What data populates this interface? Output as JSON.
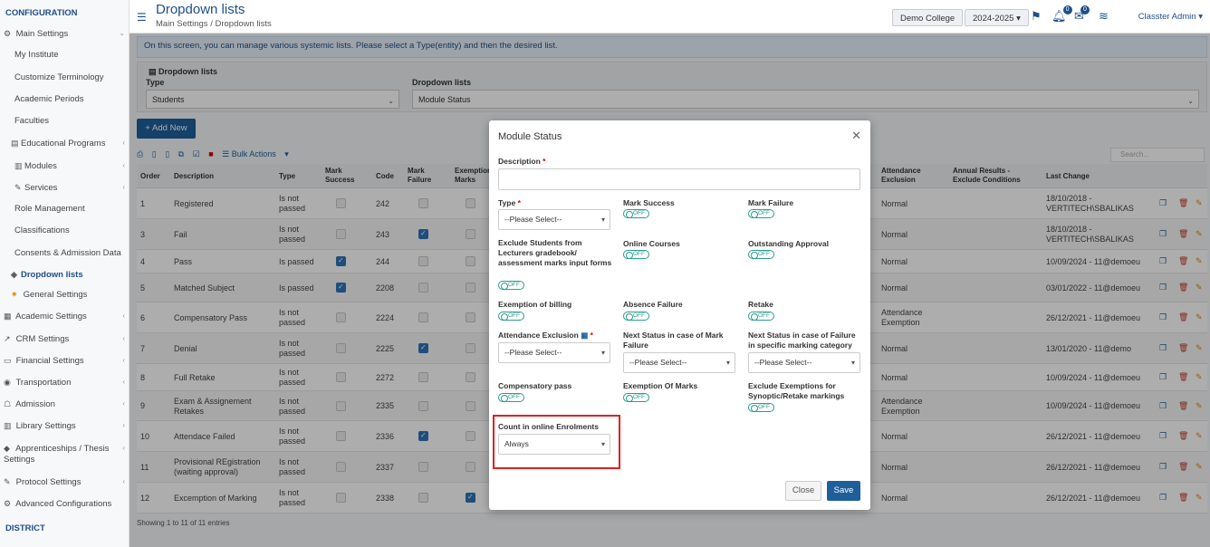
{
  "sidebar": {
    "header": "CONFIGURATION",
    "items": [
      {
        "label": "Main Settings"
      },
      {
        "label": "My Institute"
      },
      {
        "label": "Customize Terminology"
      },
      {
        "label": "Academic Periods"
      },
      {
        "label": "Faculties"
      },
      {
        "label": "Educational Programs"
      },
      {
        "label": "Modules"
      },
      {
        "label": "Services"
      },
      {
        "label": "Role Management"
      },
      {
        "label": "Classifications"
      },
      {
        "label": "Consents & Admission Data"
      },
      {
        "label": "Dropdown lists"
      },
      {
        "label": "General Settings"
      },
      {
        "label": "Academic Settings"
      },
      {
        "label": "CRM Settings"
      },
      {
        "label": "Financial Settings"
      },
      {
        "label": "Transportation"
      },
      {
        "label": "Admission"
      },
      {
        "label": "Library Settings"
      },
      {
        "label": "Apprenticeships / Thesis"
      },
      {
        "label": "Settings"
      },
      {
        "label": "Protocol Settings"
      },
      {
        "label": "Advanced Configurations"
      }
    ],
    "footer": "DISTRICT"
  },
  "header": {
    "title": "Dropdown lists",
    "breadcrumb_1": "Main Settings",
    "breadcrumb_sep": "/",
    "breadcrumb_2": "Dropdown lists",
    "college": "Demo College",
    "year": "2024-2025",
    "notif_count": "0",
    "msg_count": "0",
    "user": "Classter Admin"
  },
  "info_text": "On this screen, you can manage various systemic lists. Please select a Type(entity) and then the desired list.",
  "filter": {
    "title": "Dropdown lists",
    "type_label": "Type",
    "type_value": "Students",
    "list_label": "Dropdown lists",
    "list_value": "Module Status"
  },
  "add_new": "+ Add New",
  "bulk_actions": "Bulk Actions",
  "search_placeholder": "Search...",
  "table": {
    "headers": {
      "order": "Order",
      "description": "Description",
      "type": "Type",
      "mark_success_1": "Mark",
      "mark_success_2": "Success",
      "code": "Code",
      "mark_failure_1": "Mark",
      "mark_failure_2": "Failure",
      "exemption_1": "Exemption",
      "exemption_2": "Marks",
      "att_excl_1": "Attendance",
      "att_excl_2": "Exclusion",
      "annual_1": "Annual Results -",
      "annual_2": "Exclude Conditions",
      "last_change": "Last Change"
    },
    "rows": [
      {
        "order": "1",
        "desc": "Registered",
        "type": "Is not passed",
        "ms": false,
        "code": "242",
        "mf": false,
        "ex": false,
        "att": "Normal",
        "last": "18/10/2018 - VERTITECH\\SBALIKAS"
      },
      {
        "order": "3",
        "desc": "Fail",
        "type": "Is not passed",
        "ms": false,
        "code": "243",
        "mf": true,
        "ex": false,
        "att": "Normal",
        "last": "18/10/2018 - VERTITECH\\SBALIKAS"
      },
      {
        "order": "4",
        "desc": "Pass",
        "type": "Is passed",
        "ms": true,
        "code": "244",
        "mf": false,
        "ex": false,
        "att": "Normal",
        "last": "10/09/2024 - 11@demoeu"
      },
      {
        "order": "5",
        "desc": "Matched Subject",
        "type": "Is passed",
        "ms": true,
        "code": "2208",
        "mf": false,
        "ex": false,
        "att": "Normal",
        "last": "03/01/2022 - 11@demoeu"
      },
      {
        "order": "6",
        "desc": "Compensatory Pass",
        "type": "Is not passed",
        "ms": false,
        "code": "2224",
        "mf": false,
        "ex": false,
        "att": "Attendance Exemption",
        "last": "26/12/2021 - 11@demoeu"
      },
      {
        "order": "7",
        "desc": "Denial",
        "type": "Is not passed",
        "ms": false,
        "code": "2225",
        "mf": true,
        "ex": false,
        "att": "Normal",
        "last": "13/01/2020 - 11@demo"
      },
      {
        "order": "8",
        "desc": "Full Retake",
        "type": "Is not passed",
        "ms": false,
        "code": "2272",
        "mf": false,
        "ex": false,
        "att": "Normal",
        "last": "10/09/2024 - 11@demoeu"
      },
      {
        "order": "9",
        "desc": "Exam & Assignement Retakes",
        "type": "Is not passed",
        "ms": false,
        "code": "2335",
        "mf": false,
        "ex": false,
        "att": "Attendance Exemption",
        "last": "10/09/2024 - 11@demoeu"
      },
      {
        "order": "10",
        "desc": "Attendace Failed",
        "type": "Is not passed",
        "ms": false,
        "code": "2336",
        "mf": true,
        "ex": false,
        "att": "Normal",
        "last": "26/12/2021 - 11@demoeu"
      },
      {
        "order": "11",
        "desc": "Provisional REgistration (waiting approval)",
        "type": "Is not passed",
        "ms": false,
        "code": "2337",
        "mf": false,
        "ex": false,
        "att": "Normal",
        "last": "26/12/2021 - 11@demoeu"
      },
      {
        "order": "12",
        "desc": "Excemption of Marking",
        "type": "Is not passed",
        "ms": false,
        "code": "2338",
        "mf": false,
        "ex": true,
        "att": "Normal",
        "last": "26/12/2021 - 11@demoeu"
      }
    ]
  },
  "showing": "Showing 1 to 11 of 11 entries",
  "modal": {
    "title": "Module Status",
    "description_label": "Description",
    "type_label": "Type",
    "type_value": "--Please Select--",
    "mark_success": "Mark Success",
    "mark_failure": "Mark Failure",
    "exclude_students": "Exclude Students from Lecturers gradebook/ assessment marks input forms",
    "online_courses": "Online Courses",
    "outstanding_approval": "Outstanding Approval",
    "exemption_billing": "Exemption of billing",
    "absence_failure": "Absence Failure",
    "retake": "Retake",
    "attendance_exclusion": "Attendance Exclusion",
    "attendance_exclusion_value": "--Please Select--",
    "next_status_mark": "Next Status in case of Mark Failure",
    "next_status_mark_value": "--Please Select--",
    "next_status_failure": "Next Status in case of Failure in specific marking category",
    "next_status_failure_value": "--Please Select--",
    "compensatory_pass": "Compensatory pass",
    "exemption_marks": "Exemption Of Marks",
    "exclude_exemptions": "Exclude Exemptions for Synoptic/Retake markings",
    "count_online": "Count in online Enrolments",
    "count_online_value": "Always",
    "off_label": "OFF",
    "close": "Close",
    "save": "Save"
  }
}
